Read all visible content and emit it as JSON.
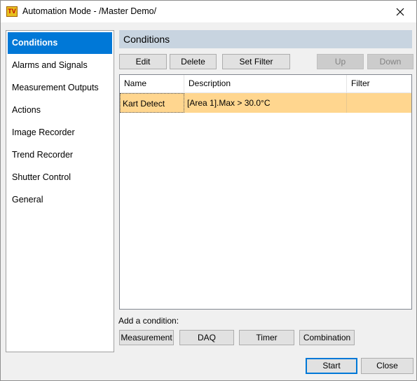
{
  "window": {
    "title": "Automation Mode - /Master Demo/",
    "app_icon_text": "TV"
  },
  "sidebar": {
    "items": [
      {
        "label": "Conditions",
        "active": true
      },
      {
        "label": "Alarms and Signals"
      },
      {
        "label": "Measurement Outputs"
      },
      {
        "label": "Actions"
      },
      {
        "label": "Image Recorder"
      },
      {
        "label": "Trend Recorder"
      },
      {
        "label": "Shutter Control"
      },
      {
        "label": "General"
      }
    ]
  },
  "main": {
    "header": "Conditions",
    "toolbar": {
      "edit": "Edit",
      "delete": "Delete",
      "set_filter": "Set Filter",
      "up": "Up",
      "down": "Down"
    },
    "table": {
      "columns": [
        "Name",
        "Description",
        "Filter"
      ],
      "rows": [
        {
          "name": "Kart Detect",
          "description": "[Area 1].Max > 30.0°C",
          "filter": ""
        }
      ]
    },
    "add_condition": {
      "label": "Add a condition:",
      "buttons": [
        "Measurement",
        "DAQ",
        "Timer",
        "Combination"
      ]
    }
  },
  "footer": {
    "start": "Start",
    "close": "Close"
  },
  "colors": {
    "accent": "#0078d7",
    "selected_row": "#ffd68f",
    "section_header": "#c8d4e0"
  }
}
